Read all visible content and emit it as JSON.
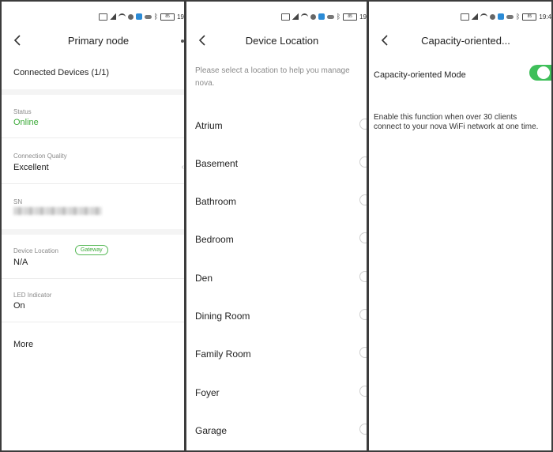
{
  "statusbar": {
    "time_fragments": [
      "19",
      "19",
      "19:4"
    ],
    "battery": "85",
    "speed": "3.2\nK/s"
  },
  "panel1": {
    "title": "Primary node",
    "connected_devices": "Connected Devices (1/1)",
    "status_label": "Status",
    "status_value": "Online",
    "quality_label": "Connection Quality",
    "quality_value": "Excellent",
    "sn_label": "SN",
    "location_label": "Device Location",
    "gateway_badge": "Gateway",
    "location_value": "N/A",
    "led_label": "LED Indicator",
    "led_value": "On",
    "more": "More"
  },
  "panel2": {
    "title": "Device Location",
    "prompt": "Please select a location to help you manage nova.",
    "locations": [
      "Atrium",
      "Basement",
      "Bathroom",
      "Bedroom",
      "Den",
      "Dining Room",
      "Family Room",
      "Foyer",
      "Garage"
    ]
  },
  "panel3": {
    "title": "Capacity-oriented...",
    "mode_label": "Capacity-oriented Mode",
    "mode_enabled": true,
    "description": "Enable this function when over 30 clients connect to your nova WiFi network at one time."
  },
  "colors": {
    "accent_green": "#3daa3a",
    "toggle_green": "#3fbf5a"
  }
}
